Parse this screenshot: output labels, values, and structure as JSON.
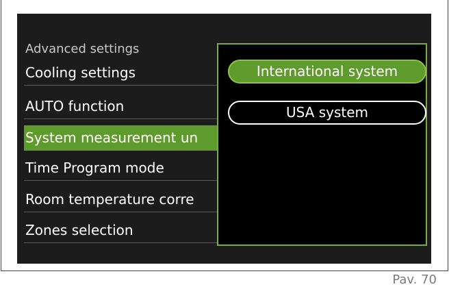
{
  "menu": {
    "heading": "Advanced settings",
    "items": [
      {
        "label": "Cooling settings"
      },
      {
        "label": "AUTO function"
      },
      {
        "label": "System measurement un"
      },
      {
        "label": "Time Program mode"
      },
      {
        "label": "Room temperature corre"
      },
      {
        "label": "Zones selection"
      }
    ],
    "selected_item": "System measurement un"
  },
  "popup": {
    "options": [
      {
        "label": "International system",
        "selected": true
      },
      {
        "label": "USA system",
        "selected": false
      }
    ]
  },
  "caption": "Pav. 70",
  "colors": {
    "screen_background": "#1c1c1c",
    "selection_green": "#5f9a2c",
    "popup_border": "#78ad3a",
    "text": "#ffffff"
  }
}
